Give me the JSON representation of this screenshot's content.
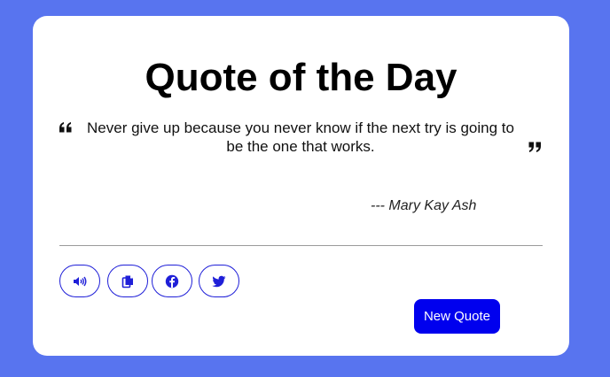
{
  "card": {
    "title": "Quote of the Day",
    "quote_text": "Never give up because you never know if the next try is going to be the one that works.",
    "author": "--- Mary Kay Ash"
  },
  "actions": {
    "speak_icon": "volume-icon",
    "copy_icon": "copy-icon",
    "facebook_icon": "facebook-icon",
    "twitter_icon": "twitter-icon",
    "new_quote_label": "New Quote"
  },
  "colors": {
    "background": "#5874ef",
    "card": "#ffffff",
    "accent": "#0000ee",
    "button_border": "#1f1fd8"
  }
}
